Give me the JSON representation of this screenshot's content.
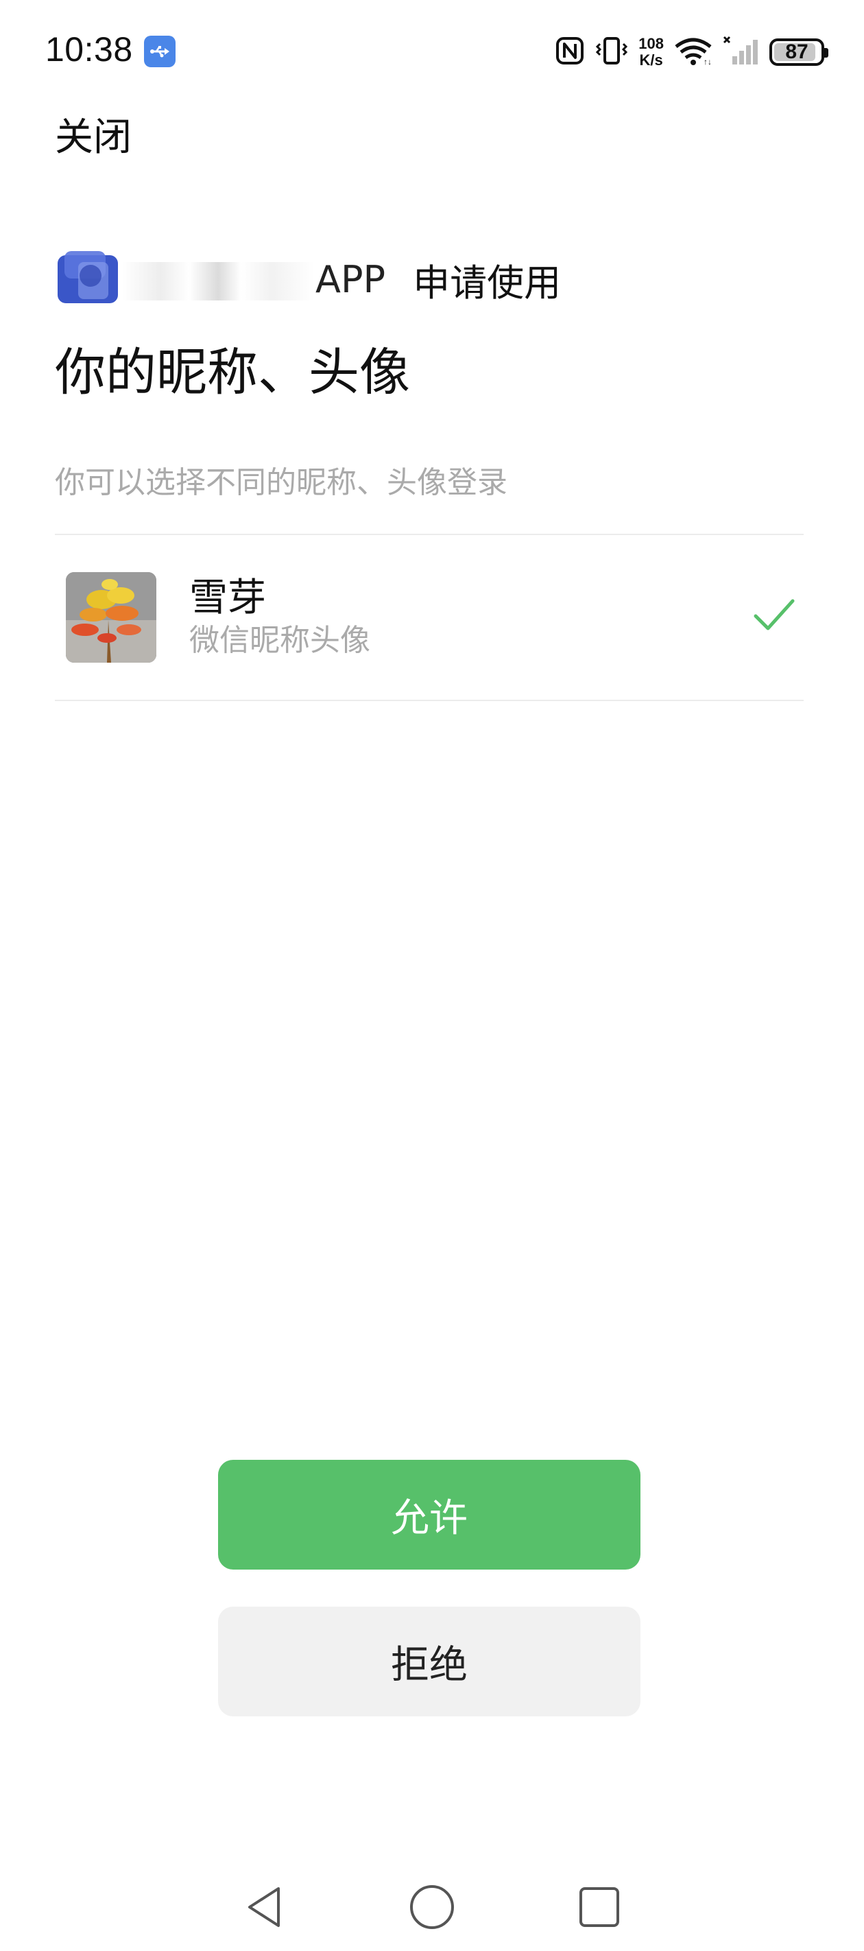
{
  "status_bar": {
    "time": "10:38",
    "net_speed_value": "108",
    "net_speed_unit": "K/s",
    "battery_level": "87",
    "icons": [
      "usb-icon",
      "nfc-icon",
      "vibrate-icon",
      "wifi-icon",
      "signal-icon",
      "battery-icon"
    ]
  },
  "header": {
    "close_label": "关闭"
  },
  "request": {
    "app_name": "APP",
    "request_text": "申请使用",
    "title": "你的昵称、头像",
    "hint": "你可以选择不同的昵称、头像登录"
  },
  "profile": {
    "name": "雪芽",
    "subtitle": "微信昵称头像",
    "selected": true
  },
  "actions": {
    "allow_label": "允许",
    "deny_label": "拒绝"
  },
  "colors": {
    "accent_green": "#57c06a",
    "check_green": "#57c06a",
    "deny_bg": "#f1f1f1",
    "hint_gray": "#aaaaaa"
  },
  "nav": {
    "icons": [
      "back-icon",
      "home-icon",
      "recents-icon"
    ]
  }
}
